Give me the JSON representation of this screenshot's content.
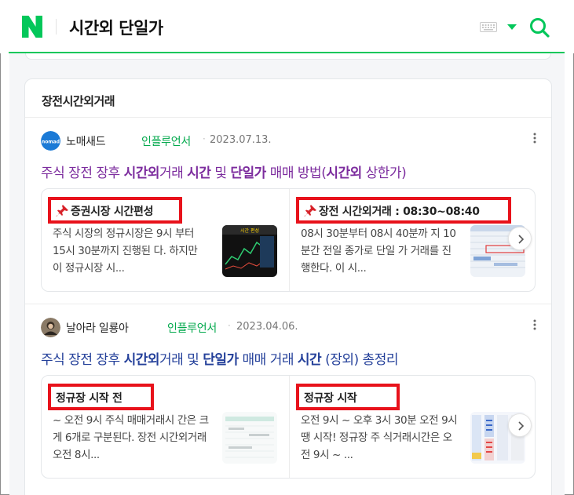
{
  "header": {
    "query": "시간외 단일가",
    "accent": "#03c75a"
  },
  "card": {
    "title": "장전시간외거래"
  },
  "items": [
    {
      "author": "노매새드",
      "badge": "인플루언서",
      "dot": "·",
      "date": "2023.07.13.",
      "title_color": "#7c2c9e",
      "title": [
        {
          "text": "주식 장전 장후 ",
          "bold": false
        },
        {
          "text": "시간외",
          "bold": true
        },
        {
          "text": "거래 ",
          "bold": false
        },
        {
          "text": "시간",
          "bold": true
        },
        {
          "text": " 및 ",
          "bold": false
        },
        {
          "text": "단일가",
          "bold": true
        },
        {
          "text": " 매매 방법(",
          "bold": false
        },
        {
          "text": "시간외",
          "bold": true
        },
        {
          "text": " 상한가)",
          "bold": false
        }
      ],
      "subs": [
        {
          "heading": "증권시장 시간편성",
          "pin": true,
          "body": "주식 시장의 정규시장은 9시 부터 15시 30분까지 진행된 다. 하지만 이 정규시장 시...",
          "thumb": "chart-screen-thumbnail"
        },
        {
          "heading": "장전 시간외거래 : 08:30~08:40",
          "pin": true,
          "body": "08시 30분부터 08시 40분까 지 10분간 전일 종가로 단일 가 거래를 진행한다. 이 시...",
          "thumb": "trading-table-thumbnail"
        }
      ]
    },
    {
      "author": "날아라 일룡아",
      "badge": "인플루언서",
      "dot": "·",
      "date": "2023.04.06.",
      "title_color": "#24409a",
      "title": [
        {
          "text": "주식 장전 장후 ",
          "bold": false
        },
        {
          "text": "시간외",
          "bold": true
        },
        {
          "text": "거래 및 ",
          "bold": false
        },
        {
          "text": "단일가",
          "bold": true
        },
        {
          "text": " 매매 거래 ",
          "bold": false
        },
        {
          "text": "시간",
          "bold": true
        },
        {
          "text": " (장외) 총정리",
          "bold": false
        }
      ],
      "subs": [
        {
          "heading": "정규장 시작 전",
          "pin": false,
          "body": "~ 오전 9시 주식 매매거래시 간은 크게 6개로 구분된다. 장전 시간외거래 오전 8시...",
          "thumb": "schedule-table-thumbnail"
        },
        {
          "heading": "정규장 시작",
          "pin": false,
          "body": "오전 9시 ~ 오후 3시 30분 오전 9시 땡 시작! 정규장 주 식거래시간은 오전 9시 ~ ...",
          "thumb": "orderbook-thumbnail"
        }
      ]
    }
  ],
  "highlight_color": "#e8121b"
}
